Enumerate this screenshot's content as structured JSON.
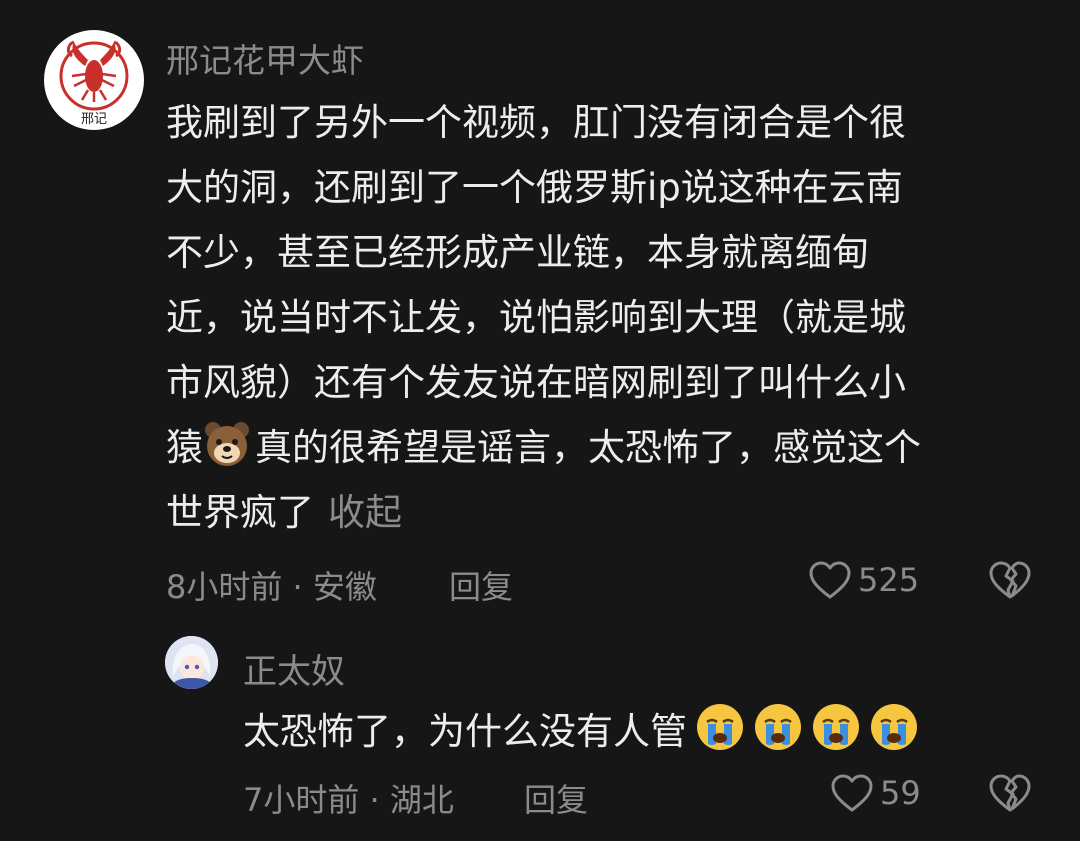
{
  "comment": {
    "username": "邢记花甲大虾",
    "avatar_text": "邢记",
    "lines": [
      "我刷到了另外一个视频，肛门没有闭合是个很",
      "大的洞，还刷到了一个俄罗斯ip说这种在云南",
      "不少，甚至已经形成产业链，本身就离缅甸",
      "近，说当时不让发，说怕影响到大理（就是城",
      "市风貌）还有个发友说在暗网刷到了叫什么小"
    ],
    "line6_start": "猿",
    "line6_rest": "真的很希望是谣言，太恐怖了，感觉这个",
    "line7": "世界疯了",
    "collapse_label": "收起",
    "meta": "8小时前 · 安徽",
    "reply_label": "回复",
    "likes": "525",
    "emoji": "dog-face-emoji"
  },
  "reply": {
    "username": "正太奴",
    "text": "太恐怖了，为什么没有人管",
    "emoji_count": 4,
    "emoji": "crying-face-emoji",
    "meta": "7小时前 · 湖北",
    "reply_label": "回复",
    "likes": "59"
  },
  "colors": {
    "background": "#161616",
    "primary_text": "#ededed",
    "secondary_text": "#8b8b8b"
  }
}
